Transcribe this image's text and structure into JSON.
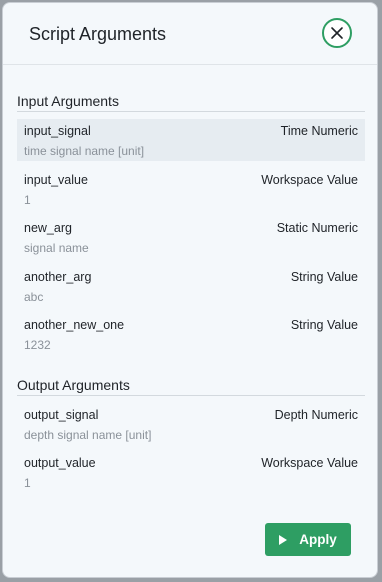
{
  "dialog": {
    "title": "Script Arguments",
    "close_icon": "close-icon",
    "accent_color": "#2e9e63"
  },
  "input_section": {
    "title": "Input Arguments",
    "args": [
      {
        "name": "input_signal",
        "type": "Time Numeric",
        "value": "time signal name [unit]",
        "selected": true
      },
      {
        "name": "input_value",
        "type": "Workspace Value",
        "value": "1"
      },
      {
        "name": "new_arg",
        "type": "Static Numeric",
        "value": "signal name"
      },
      {
        "name": "another_arg",
        "type": "String Value",
        "value": "abc"
      },
      {
        "name": "another_new_one",
        "type": "String Value",
        "value": "1232"
      }
    ]
  },
  "output_section": {
    "title": "Output Arguments",
    "args": [
      {
        "name": "output_signal",
        "type": "Depth Numeric",
        "value": "depth signal name [unit]"
      },
      {
        "name": "output_value",
        "type": "Workspace Value",
        "value": "1"
      }
    ]
  },
  "footer": {
    "apply_label": "Apply",
    "apply_icon": "play-icon"
  }
}
